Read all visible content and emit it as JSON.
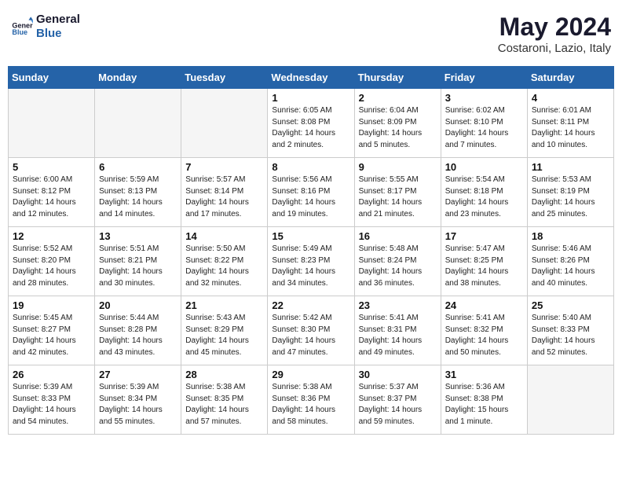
{
  "header": {
    "logo_line1": "General",
    "logo_line2": "Blue",
    "month": "May 2024",
    "location": "Costaroni, Lazio, Italy"
  },
  "weekdays": [
    "Sunday",
    "Monday",
    "Tuesday",
    "Wednesday",
    "Thursday",
    "Friday",
    "Saturday"
  ],
  "weeks": [
    [
      {
        "day": "",
        "info": ""
      },
      {
        "day": "",
        "info": ""
      },
      {
        "day": "",
        "info": ""
      },
      {
        "day": "1",
        "info": "Sunrise: 6:05 AM\nSunset: 8:08 PM\nDaylight: 14 hours\nand 2 minutes."
      },
      {
        "day": "2",
        "info": "Sunrise: 6:04 AM\nSunset: 8:09 PM\nDaylight: 14 hours\nand 5 minutes."
      },
      {
        "day": "3",
        "info": "Sunrise: 6:02 AM\nSunset: 8:10 PM\nDaylight: 14 hours\nand 7 minutes."
      },
      {
        "day": "4",
        "info": "Sunrise: 6:01 AM\nSunset: 8:11 PM\nDaylight: 14 hours\nand 10 minutes."
      }
    ],
    [
      {
        "day": "5",
        "info": "Sunrise: 6:00 AM\nSunset: 8:12 PM\nDaylight: 14 hours\nand 12 minutes."
      },
      {
        "day": "6",
        "info": "Sunrise: 5:59 AM\nSunset: 8:13 PM\nDaylight: 14 hours\nand 14 minutes."
      },
      {
        "day": "7",
        "info": "Sunrise: 5:57 AM\nSunset: 8:14 PM\nDaylight: 14 hours\nand 17 minutes."
      },
      {
        "day": "8",
        "info": "Sunrise: 5:56 AM\nSunset: 8:16 PM\nDaylight: 14 hours\nand 19 minutes."
      },
      {
        "day": "9",
        "info": "Sunrise: 5:55 AM\nSunset: 8:17 PM\nDaylight: 14 hours\nand 21 minutes."
      },
      {
        "day": "10",
        "info": "Sunrise: 5:54 AM\nSunset: 8:18 PM\nDaylight: 14 hours\nand 23 minutes."
      },
      {
        "day": "11",
        "info": "Sunrise: 5:53 AM\nSunset: 8:19 PM\nDaylight: 14 hours\nand 25 minutes."
      }
    ],
    [
      {
        "day": "12",
        "info": "Sunrise: 5:52 AM\nSunset: 8:20 PM\nDaylight: 14 hours\nand 28 minutes."
      },
      {
        "day": "13",
        "info": "Sunrise: 5:51 AM\nSunset: 8:21 PM\nDaylight: 14 hours\nand 30 minutes."
      },
      {
        "day": "14",
        "info": "Sunrise: 5:50 AM\nSunset: 8:22 PM\nDaylight: 14 hours\nand 32 minutes."
      },
      {
        "day": "15",
        "info": "Sunrise: 5:49 AM\nSunset: 8:23 PM\nDaylight: 14 hours\nand 34 minutes."
      },
      {
        "day": "16",
        "info": "Sunrise: 5:48 AM\nSunset: 8:24 PM\nDaylight: 14 hours\nand 36 minutes."
      },
      {
        "day": "17",
        "info": "Sunrise: 5:47 AM\nSunset: 8:25 PM\nDaylight: 14 hours\nand 38 minutes."
      },
      {
        "day": "18",
        "info": "Sunrise: 5:46 AM\nSunset: 8:26 PM\nDaylight: 14 hours\nand 40 minutes."
      }
    ],
    [
      {
        "day": "19",
        "info": "Sunrise: 5:45 AM\nSunset: 8:27 PM\nDaylight: 14 hours\nand 42 minutes."
      },
      {
        "day": "20",
        "info": "Sunrise: 5:44 AM\nSunset: 8:28 PM\nDaylight: 14 hours\nand 43 minutes."
      },
      {
        "day": "21",
        "info": "Sunrise: 5:43 AM\nSunset: 8:29 PM\nDaylight: 14 hours\nand 45 minutes."
      },
      {
        "day": "22",
        "info": "Sunrise: 5:42 AM\nSunset: 8:30 PM\nDaylight: 14 hours\nand 47 minutes."
      },
      {
        "day": "23",
        "info": "Sunrise: 5:41 AM\nSunset: 8:31 PM\nDaylight: 14 hours\nand 49 minutes."
      },
      {
        "day": "24",
        "info": "Sunrise: 5:41 AM\nSunset: 8:32 PM\nDaylight: 14 hours\nand 50 minutes."
      },
      {
        "day": "25",
        "info": "Sunrise: 5:40 AM\nSunset: 8:33 PM\nDaylight: 14 hours\nand 52 minutes."
      }
    ],
    [
      {
        "day": "26",
        "info": "Sunrise: 5:39 AM\nSunset: 8:33 PM\nDaylight: 14 hours\nand 54 minutes."
      },
      {
        "day": "27",
        "info": "Sunrise: 5:39 AM\nSunset: 8:34 PM\nDaylight: 14 hours\nand 55 minutes."
      },
      {
        "day": "28",
        "info": "Sunrise: 5:38 AM\nSunset: 8:35 PM\nDaylight: 14 hours\nand 57 minutes."
      },
      {
        "day": "29",
        "info": "Sunrise: 5:38 AM\nSunset: 8:36 PM\nDaylight: 14 hours\nand 58 minutes."
      },
      {
        "day": "30",
        "info": "Sunrise: 5:37 AM\nSunset: 8:37 PM\nDaylight: 14 hours\nand 59 minutes."
      },
      {
        "day": "31",
        "info": "Sunrise: 5:36 AM\nSunset: 8:38 PM\nDaylight: 15 hours\nand 1 minute."
      },
      {
        "day": "",
        "info": ""
      }
    ]
  ]
}
